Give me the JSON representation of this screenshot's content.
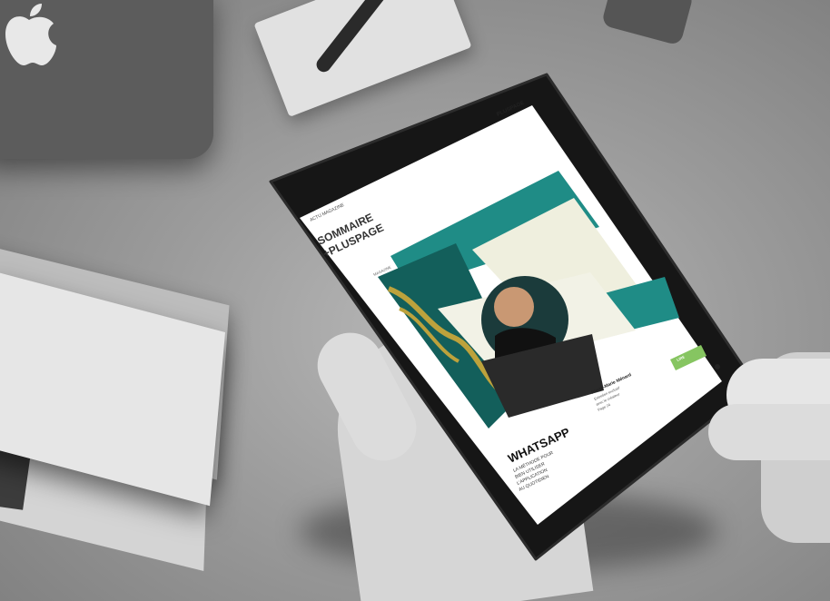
{
  "screen": {
    "brand": "PLUSPAGE",
    "top_label": "ACTU MAGAZINE",
    "headline_line1": "SOMMAIRE",
    "headline_line2": "+PLUSPAGE",
    "small_label": "MAGAZINE",
    "feature_title": "WHATSAPP",
    "feature_text_line1": "LA MÉTHODE POUR",
    "feature_text_line2": "BIEN UTILISER",
    "feature_text_line3": "L'APPLICATION",
    "feature_text_line4": "AU QUOTIDIEN",
    "side_heading": "Pierre-Marie Ménard",
    "side_text_line1": "Entretien exclusif",
    "side_text_line2": "avec le créateur",
    "side_text_line3": "Page 24",
    "cta_label": "LIRE"
  },
  "colors": {
    "teal": "#1f8c86",
    "teal_dark": "#135f5b",
    "cream": "#efefde",
    "gold": "#bda23c",
    "cta_green": "#86c561",
    "bezel": "#1a1a1a"
  },
  "icons": [
    "apple-logo-icon",
    "page-dot-icon"
  ]
}
